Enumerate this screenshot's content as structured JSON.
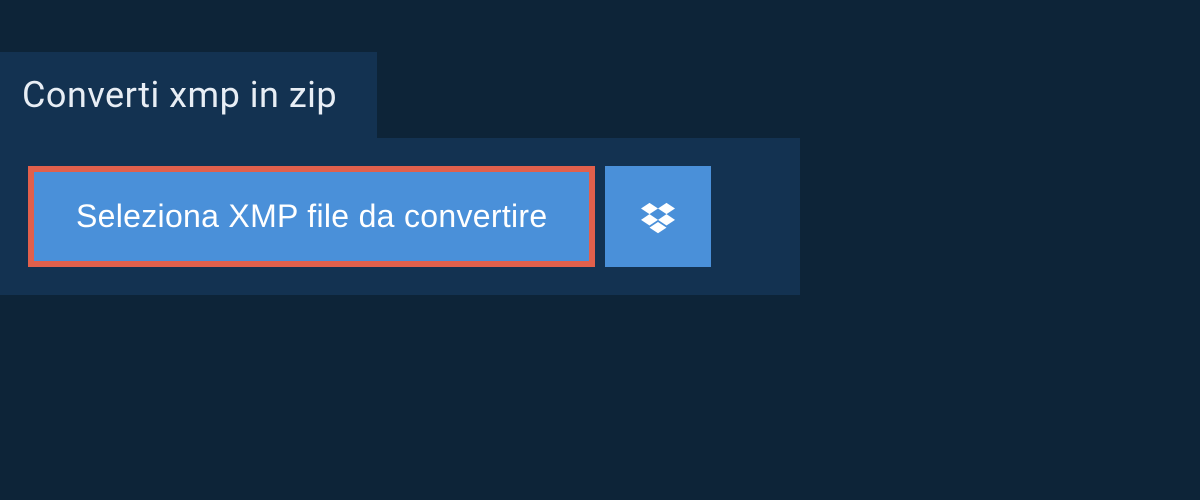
{
  "header": {
    "title": "Converti xmp in zip"
  },
  "actions": {
    "select_label": "Seleziona XMP file da convertire"
  },
  "colors": {
    "page_bg": "#0d2438",
    "panel_bg": "#133251",
    "button_bg": "#4a90d9",
    "highlight_border": "#e1604c",
    "text_light": "#e8eef5",
    "text_white": "#ffffff"
  }
}
